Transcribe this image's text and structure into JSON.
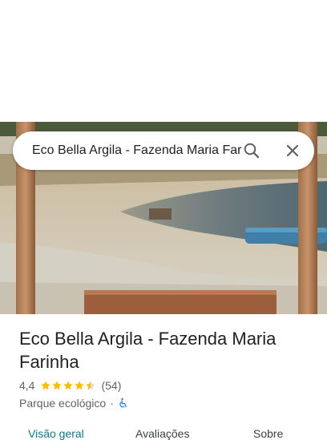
{
  "search": {
    "query": "Eco Bella Argila - Fazenda Maria Farinha"
  },
  "place": {
    "name": "Eco Bella Argila - Fazenda Maria Farinha",
    "rating": "4,4",
    "rating_stars": 4.4,
    "review_count": "(54)",
    "category": "Parque ecológico",
    "separator": "·"
  },
  "tabs": [
    {
      "label": "Visão geral",
      "active": true
    },
    {
      "label": "Avaliações",
      "active": false
    },
    {
      "label": "Sobre",
      "active": false
    }
  ],
  "colors": {
    "star": "#fbbc04",
    "active_tab": "#0b7a8a",
    "accessibility": "#1a73e8"
  },
  "icons": {
    "search": "search-icon",
    "close": "close-icon",
    "accessibility": "wheelchair-accessible-icon"
  }
}
